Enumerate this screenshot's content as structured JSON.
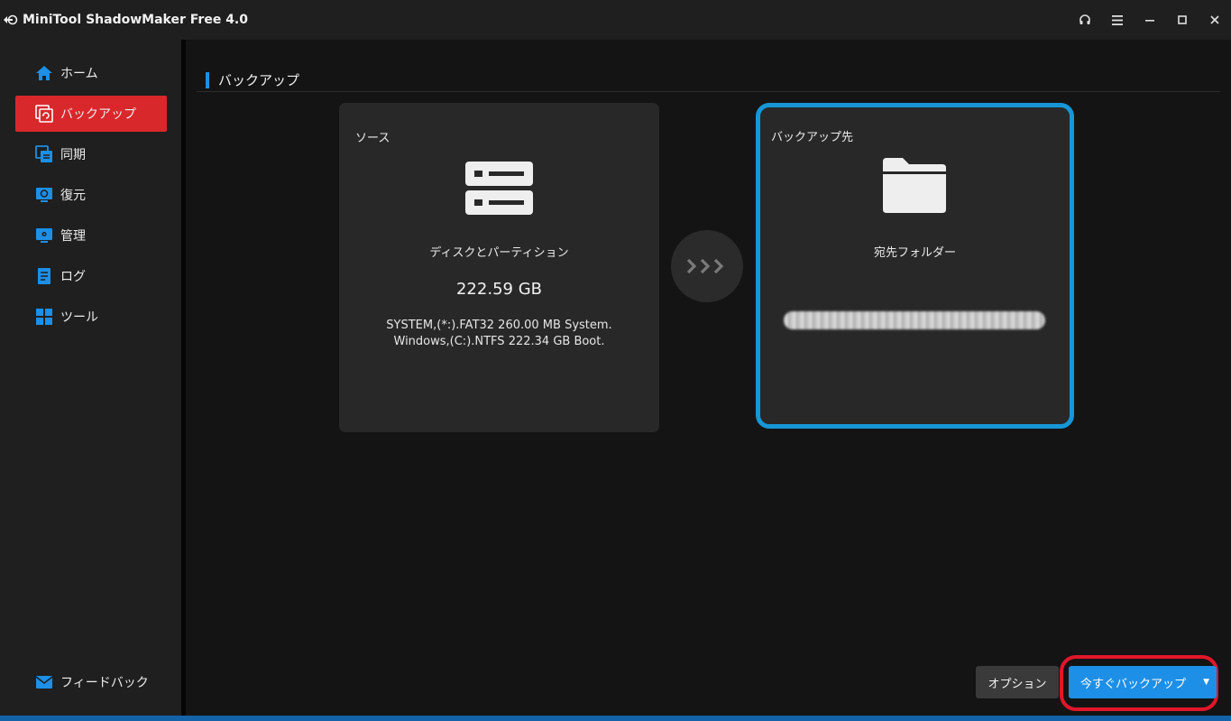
{
  "window": {
    "title": "MiniTool ShadowMaker Free 4.0",
    "controls": {
      "support_icon": "headset-icon",
      "menu_icon": "hamburger-menu-icon",
      "minimize_icon": "minimize-icon",
      "maximize_icon": "maximize-icon",
      "close_icon": "close-icon"
    }
  },
  "sidebar": {
    "items": [
      {
        "label": "ホーム",
        "icon": "home-icon",
        "active": false
      },
      {
        "label": "バックアップ",
        "icon": "backup-icon",
        "active": true
      },
      {
        "label": "同期",
        "icon": "sync-icon",
        "active": false
      },
      {
        "label": "復元",
        "icon": "restore-icon",
        "active": false
      },
      {
        "label": "管理",
        "icon": "manage-icon",
        "active": false
      },
      {
        "label": "ログ",
        "icon": "log-icon",
        "active": false
      },
      {
        "label": "ツール",
        "icon": "tools-icon",
        "active": false
      }
    ],
    "feedback_label": "フィードバック"
  },
  "main": {
    "title": "バックアップ",
    "source": {
      "label": "ソース",
      "title": "ディスクとパーティション",
      "size": "222.59 GB",
      "detail_line1": "SYSTEM,(*:).FAT32 260.00 MB System.",
      "detail_line2": "Windows,(C:).NTFS 222.34 GB Boot."
    },
    "destination": {
      "label": "バックアップ先",
      "title": "宛先フォルダー"
    },
    "buttons": {
      "options": "オプション",
      "backup_now": "今すぐバックアップ",
      "backup_caret": "▼"
    }
  },
  "colors": {
    "accent_blue": "#1d8fe6",
    "active_red": "#d9282c",
    "highlight_red": "#e2162a",
    "dest_border": "#1796d6"
  }
}
